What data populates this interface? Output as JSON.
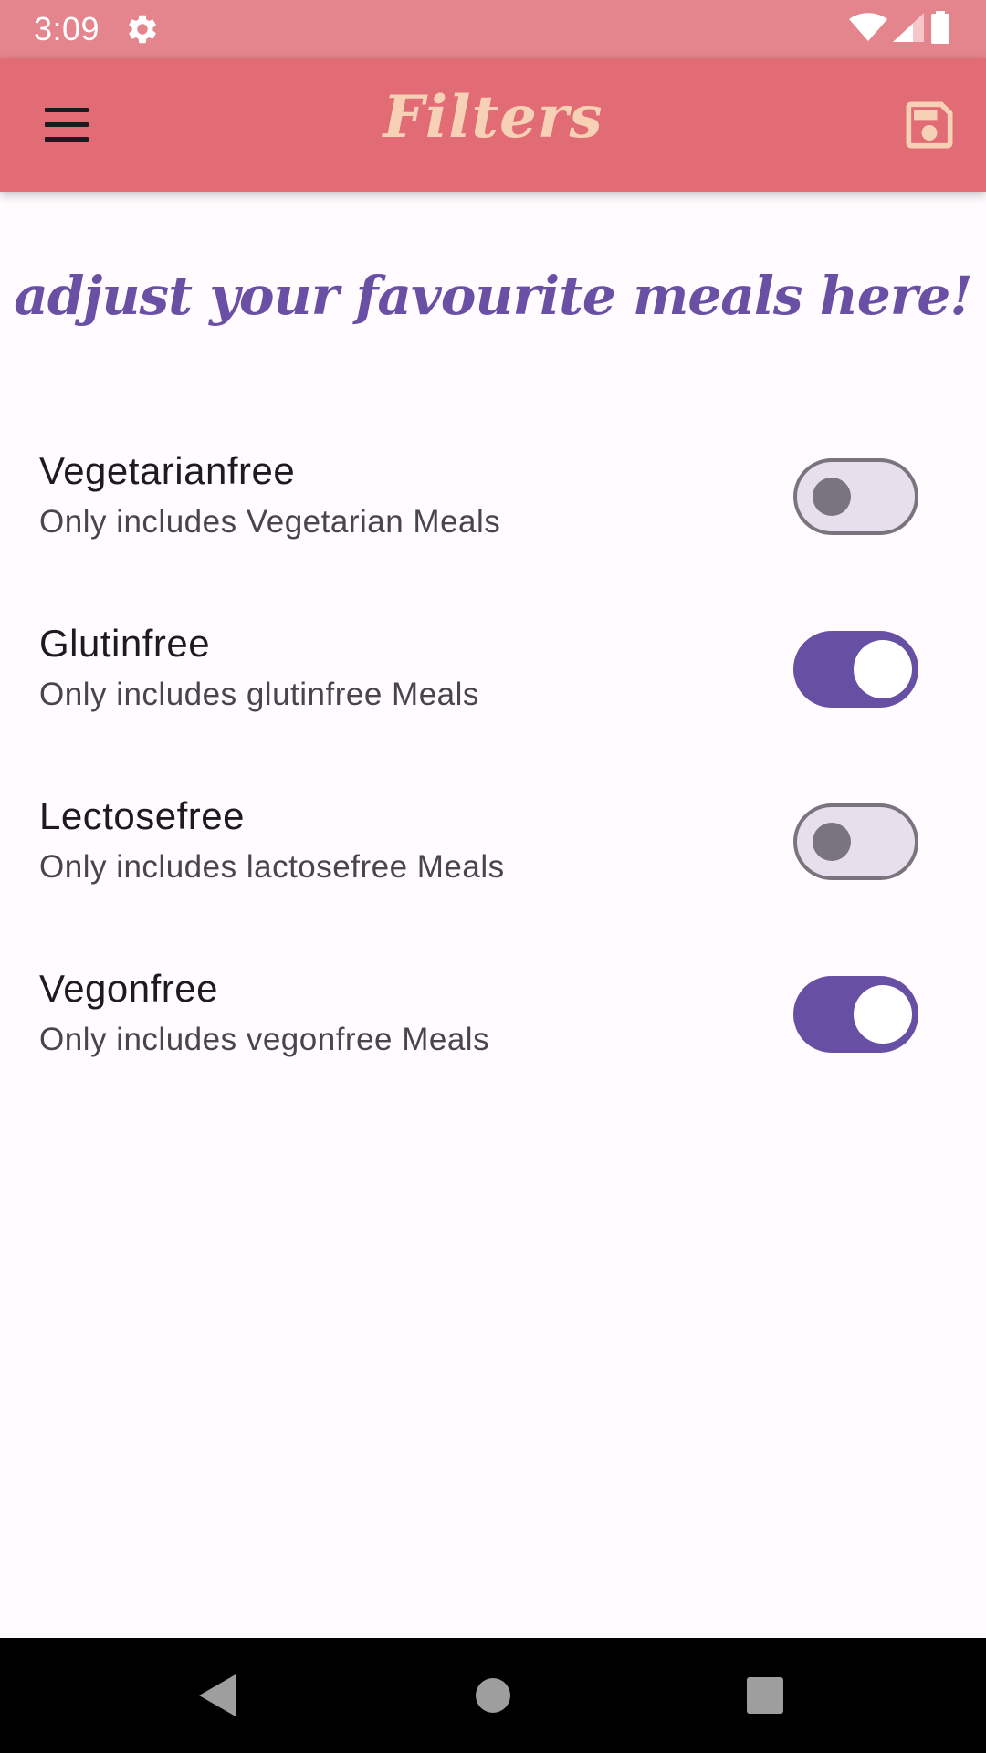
{
  "status_bar": {
    "time": "3:09",
    "icons": [
      "settings-icon",
      "wifi-icon",
      "cellular-signal-icon",
      "battery-icon"
    ]
  },
  "app_bar": {
    "title": "Filters",
    "menu_icon": "hamburger-menu-icon",
    "save_icon": "save-floppy-icon"
  },
  "headline": "adjust your favourite meals here!",
  "filters": [
    {
      "title": "Vegetarianfree",
      "subtitle": "Only includes Vegetarian Meals",
      "enabled": false
    },
    {
      "title": "Glutinfree",
      "subtitle": "Only includes glutinfree Meals",
      "enabled": true
    },
    {
      "title": "Lectosefree",
      "subtitle": "Only includes lactosefree Meals",
      "enabled": false
    },
    {
      "title": "Vegonfree",
      "subtitle": "Only includes vegonfree Meals",
      "enabled": true
    }
  ],
  "nav_bar": {
    "buttons": [
      "back-icon",
      "home-icon",
      "recents-icon"
    ]
  },
  "colors": {
    "app_bar": "#e26c76",
    "status_bar": "#e4848c",
    "title_text": "#f7d1b5",
    "headline_text": "#6a50a4",
    "switch_on": "#6750a4",
    "switch_off_track": "#e7e0ec",
    "switch_off_outline": "#79747e",
    "background": "#fffbfe"
  }
}
